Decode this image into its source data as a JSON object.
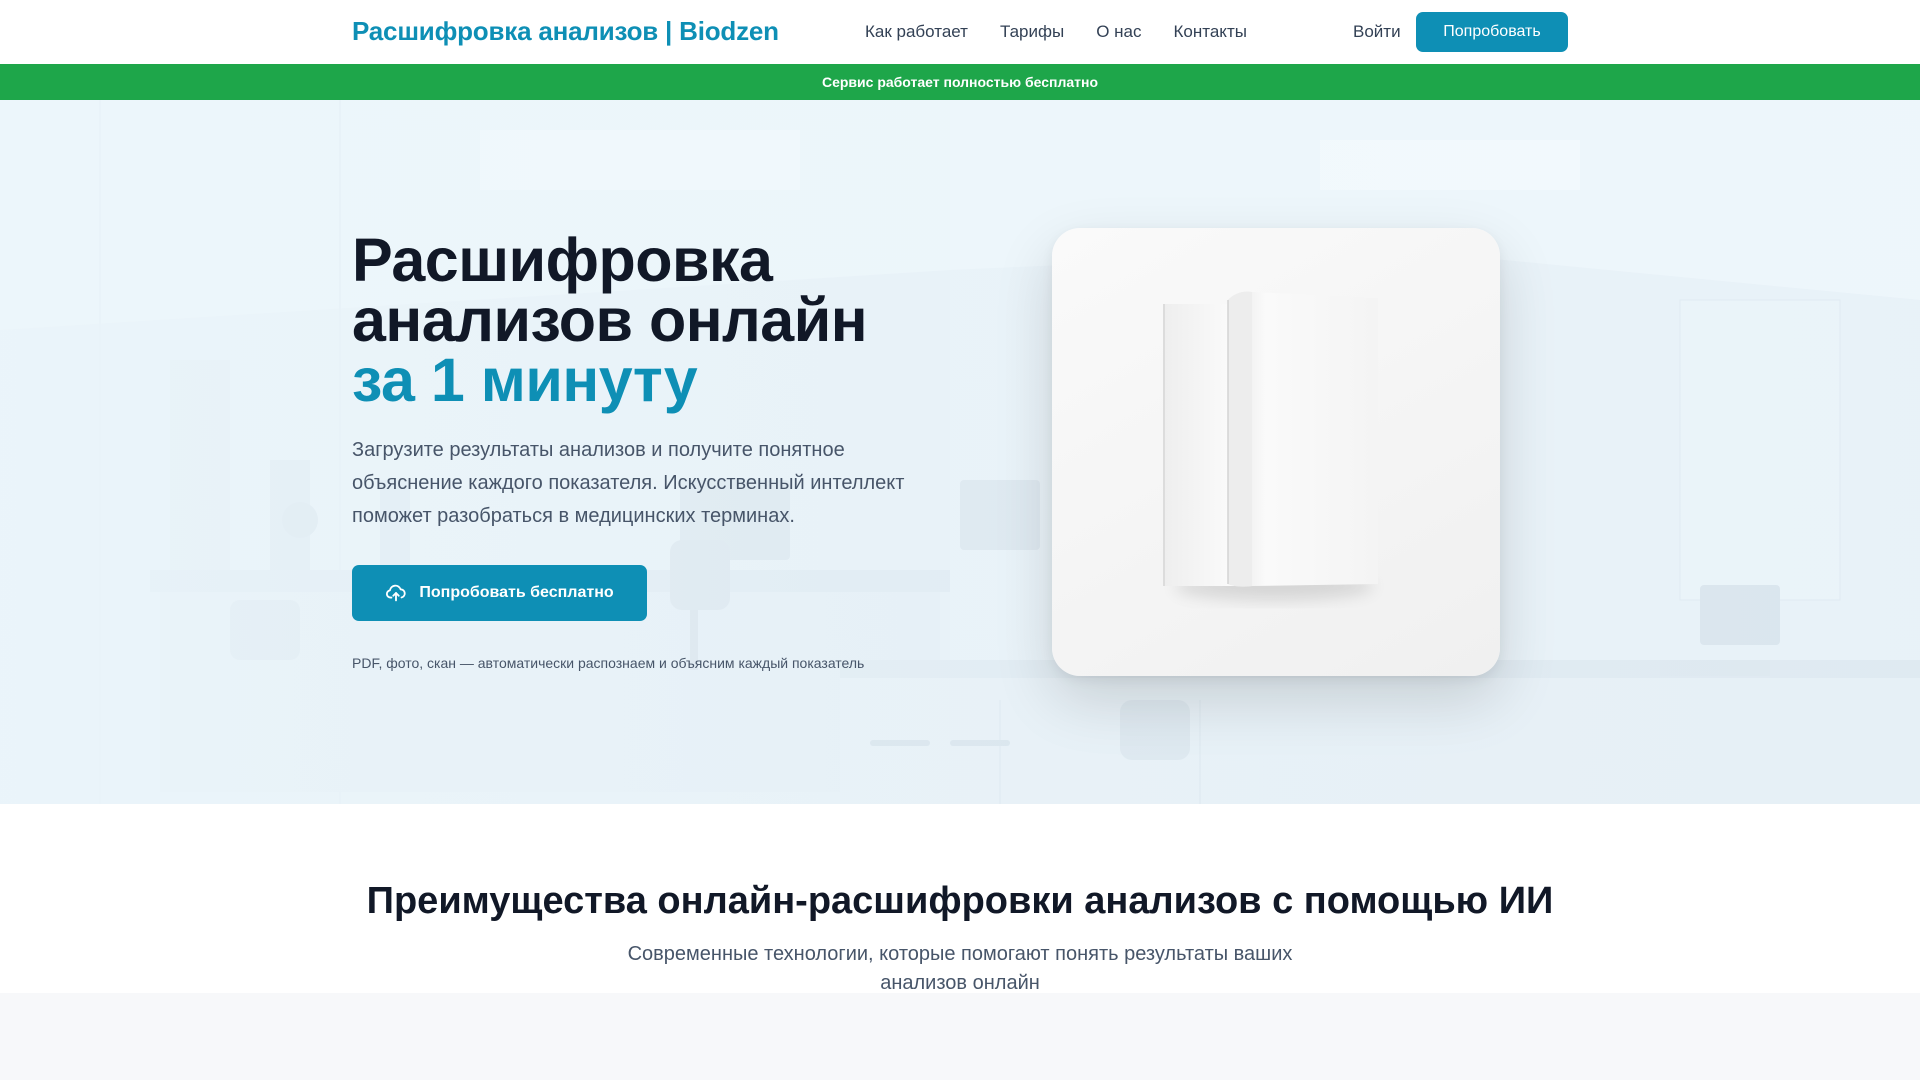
{
  "header": {
    "logo": "Расшифровка анализов | Biodzen",
    "nav": [
      "Как работает",
      "Тарифы",
      "О нас",
      "Контакты"
    ],
    "login_label": "Войти",
    "cta_label": "Попробовать"
  },
  "banner": {
    "text": "Сервис работает полностью бесплатно"
  },
  "hero": {
    "title_line1": "Расшифровка",
    "title_line2": "анализов онлайн",
    "title_accent": "за 1 минуту",
    "subtitle": "Загрузите результаты анализов и получите понятное объяснение каждого показателя. Искусственный интеллект поможет разобраться в медицинских терминах.",
    "button_label": "Попробовать бесплатно",
    "button_icon": "cloud-upload-icon",
    "note": "PDF, фото, скан — автоматически распознаем и объясним каждый показатель"
  },
  "advantages": {
    "title": "Преимущества онлайн-расшифровки анализов с помощью ИИ",
    "subtitle": "Современные технологии, которые помогают понять результаты ваших анализов онлайн"
  },
  "colors": {
    "brand": "#0e8fb5",
    "banner": "#1ea64a",
    "heading": "#111827",
    "body_text": "#475569"
  }
}
